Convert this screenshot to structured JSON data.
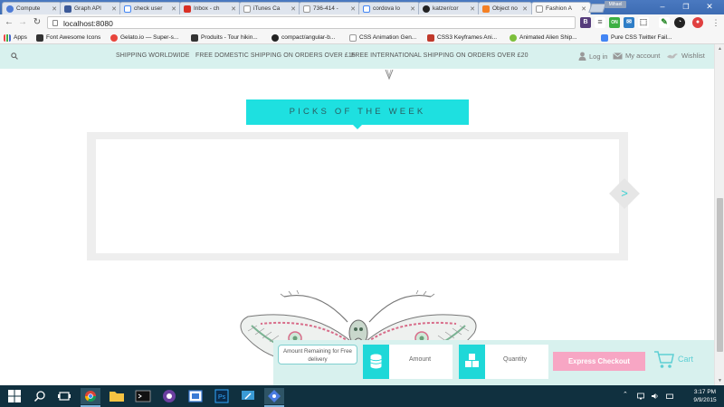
{
  "browser": {
    "tabs": [
      {
        "title": "Compute",
        "color": "#4d7bd6"
      },
      {
        "title": "Graph API",
        "color": "#3b5998"
      },
      {
        "title": "check user",
        "color": "#4285f4"
      },
      {
        "title": "Inbox - ch",
        "color": "#d93025"
      },
      {
        "title": "iTunes Ca",
        "color": "#999999"
      },
      {
        "title": "736-414 -",
        "color": "#999999"
      },
      {
        "title": "cordova lo",
        "color": "#4285f4"
      },
      {
        "title": "katzer/cor",
        "color": "#222222"
      },
      {
        "title": "Object no",
        "color": "#f48024"
      },
      {
        "title": "Fashion A",
        "color": "#999999"
      }
    ],
    "profile_label": "Mihael",
    "url": "localhost:8080",
    "bookmarks": [
      {
        "label": "Apps",
        "color": "#4285f4"
      },
      {
        "label": "Font Awesome Icons",
        "color": "#333333"
      },
      {
        "label": "Gelato.io — Super-s...",
        "color": "#e8453c"
      },
      {
        "label": "Produits - Tour hikin...",
        "color": "#333333"
      },
      {
        "label": "compact/angular-b...",
        "color": "#222222"
      },
      {
        "label": "CSS Animation Gen...",
        "color": "#999999"
      },
      {
        "label": "CSS3 Keyframes Ani...",
        "color": "#c0392b"
      },
      {
        "label": "Animated Alien Ship...",
        "color": "#7cbf3b"
      },
      {
        "label": "Pure CSS Twitter Fail...",
        "color": "#4285f4"
      }
    ]
  },
  "site": {
    "shipping": {
      "worldwide": "SHIPPING WORLDWIDE",
      "domestic": "FREE DOMESTIC SHIPPING ON ORDERS OVER £15",
      "international": "FREE INTERNATIONAL SHIPPING ON ORDERS OVER £20"
    },
    "account": {
      "login": "Log in",
      "my_account": "My account",
      "wishlist": "Wishlist"
    },
    "picks_title": "PICKS OF THE WEEK",
    "carousel_next": ">",
    "checkout": {
      "amount_remaining_label": "Amount Remaining for Free delivery",
      "amount_label": "Amount",
      "quantity_label": "Quantity",
      "express_label": "Express Checkout",
      "cart_label": "Cart"
    }
  },
  "taskbar": {
    "time": "3:17 PM",
    "date": "9/9/2015"
  },
  "colors": {
    "accent_cyan": "#1ee0e0",
    "header_bg": "#d8f1ee",
    "express_pink": "#f7a6c4"
  }
}
